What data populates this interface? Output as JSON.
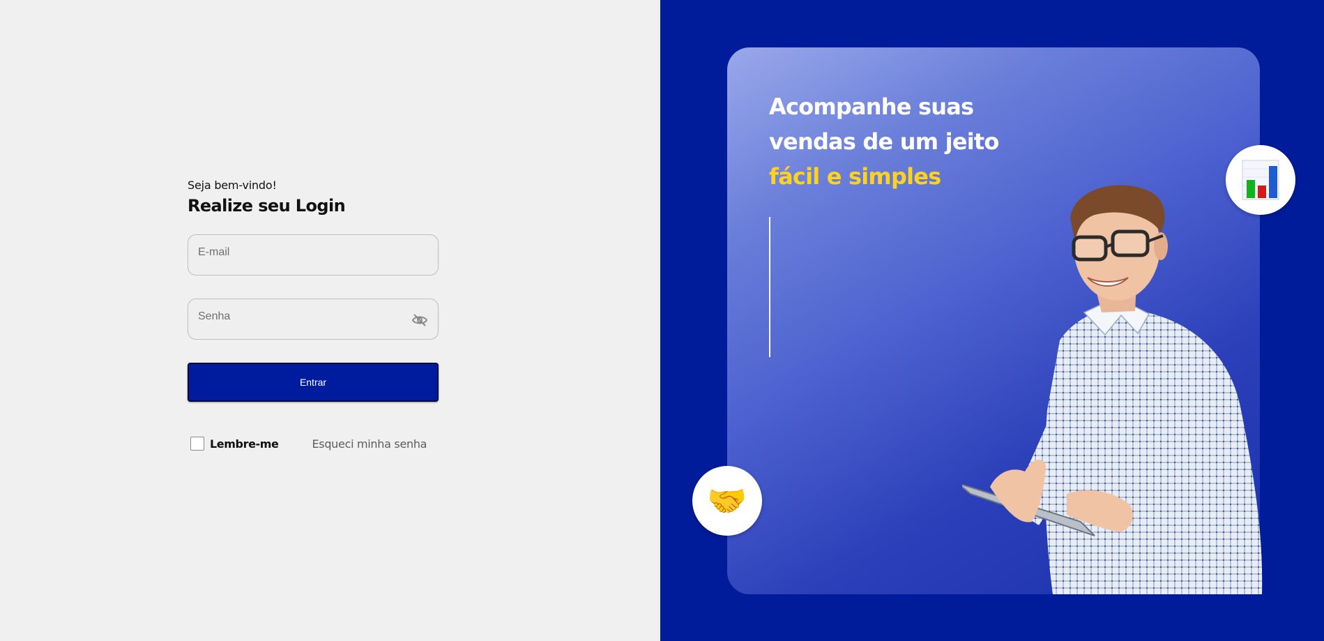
{
  "login": {
    "welcome": "Seja bem-vindo!",
    "title": "Realize seu Login",
    "email_placeholder": "E-mail",
    "password_placeholder": "Senha",
    "submit_label": "Entrar",
    "remember_label": "Lembre-me",
    "forgot_label": "Esqueci minha senha"
  },
  "promo": {
    "line1": "Acompanhe suas",
    "line2": "vendas de um jeito",
    "highlight": "fácil e simples",
    "handshake_emoji": "🤝"
  },
  "icons": [
    "eye-off-icon",
    "bar-chart-icon",
    "handshake-icon"
  ],
  "colors": {
    "brand_blue": "#001c9b",
    "highlight_yellow": "#ffd21f",
    "left_background": "#f0f0f0"
  }
}
